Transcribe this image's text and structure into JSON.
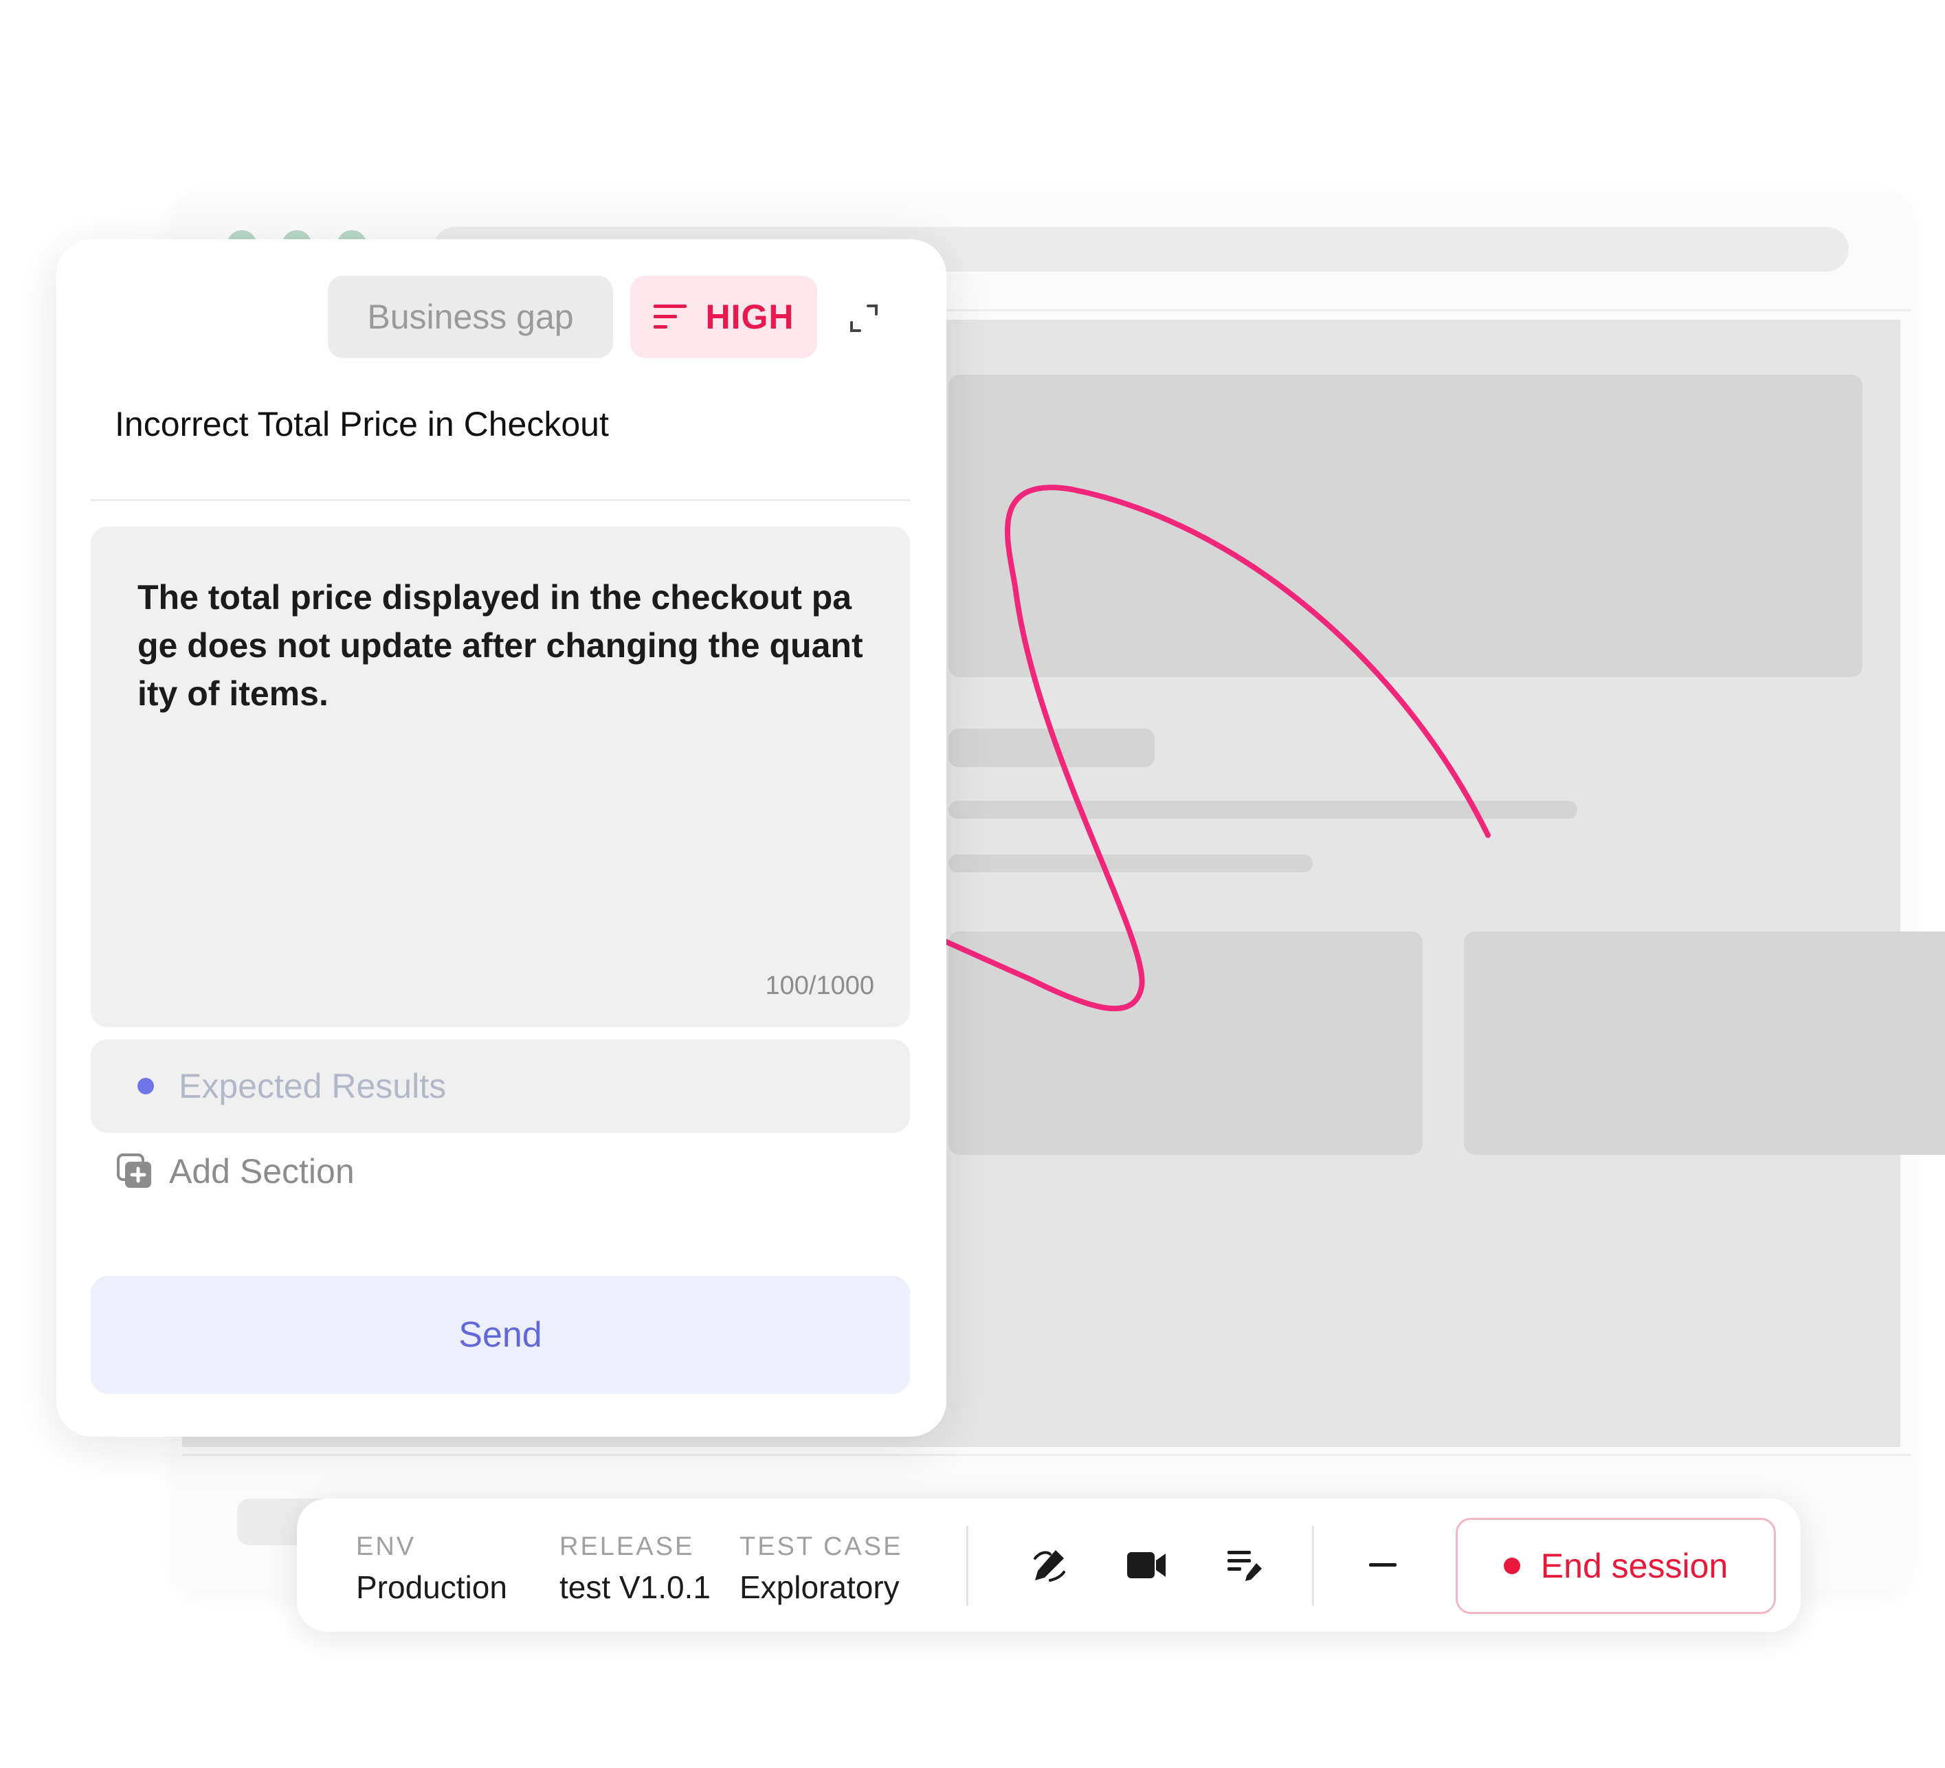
{
  "report": {
    "category_tag": "Business gap",
    "priority_tag": "HIGH",
    "title": "Incorrect Total Price in Checkout",
    "description": "The total price displayed in the checkout page does not update after changing the quantity of items.",
    "char_count": "100/1000",
    "expected_results_placeholder": "Expected Results",
    "add_section_label": "Add Section",
    "send_label": "Send"
  },
  "session": {
    "env_label": "ENV",
    "env_value": "Production",
    "release_label": "RELEASE",
    "release_value": "test V1.0.1",
    "test_case_label": "TEST CASE",
    "test_case_value": "Exploratory",
    "end_session_label": "End session"
  },
  "icons": {
    "priority": "priority-lines-icon",
    "expand": "expand-icon",
    "add_section": "add-section-icon",
    "draw": "draw-pen-icon",
    "record": "video-camera-icon",
    "notes": "notes-edit-icon",
    "minimize": "minimize-icon",
    "end_session": "record-dot-icon"
  },
  "colors": {
    "accent": "#e8194f",
    "primary": "#6268d8",
    "scribble": "#f0267a",
    "end_session": "#e8193a"
  }
}
